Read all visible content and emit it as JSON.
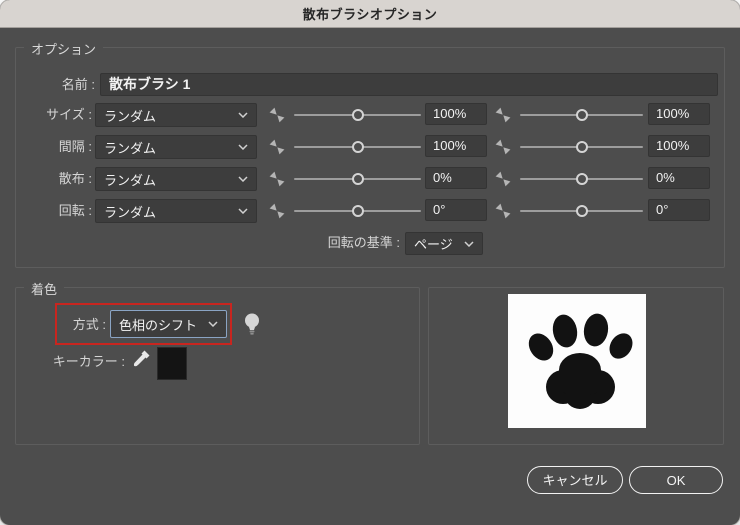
{
  "window": {
    "title": "散布ブラシオプション"
  },
  "options_group": {
    "legend": "オプション",
    "name_label": "名前 :",
    "name_value": "散布ブラシ 1",
    "rows": [
      {
        "label": "サイズ :",
        "dropdown": "ランダム",
        "value1": "100%",
        "value2": "100%"
      },
      {
        "label": "間隔 :",
        "dropdown": "ランダム",
        "value1": "100%",
        "value2": "100%"
      },
      {
        "label": "散布 :",
        "dropdown": "ランダム",
        "value1": "0%",
        "value2": "0%"
      },
      {
        "label": "回転 :",
        "dropdown": "ランダム",
        "value1": "0°",
        "value2": "0°"
      }
    ],
    "rotation_basis_label": "回転の基準 :",
    "rotation_basis_value": "ページ"
  },
  "colorization_group": {
    "legend": "着色",
    "method_label": "方式 :",
    "method_value": "色相のシフト",
    "key_color_label": "キーカラー :"
  },
  "footer": {
    "cancel_label": "キャンセル",
    "ok_label": "OK"
  },
  "icons": {
    "chevron_down": "˅",
    "slider_adjust": "diagonal-bowtie",
    "lightbulb": "tips-bulb",
    "eyedropper": "key-color-picker",
    "preview_glyph": "paw-print"
  },
  "colors": {
    "dialog_bg": "#4d4d4d",
    "titlebar_bg": "#d8d4d0",
    "control_bg": "#3d3d3d",
    "annotation_red": "#c9251f",
    "focus_blue": "#8aa4c4",
    "key_color_swatch": "#141414",
    "paw_black": "#121212"
  }
}
